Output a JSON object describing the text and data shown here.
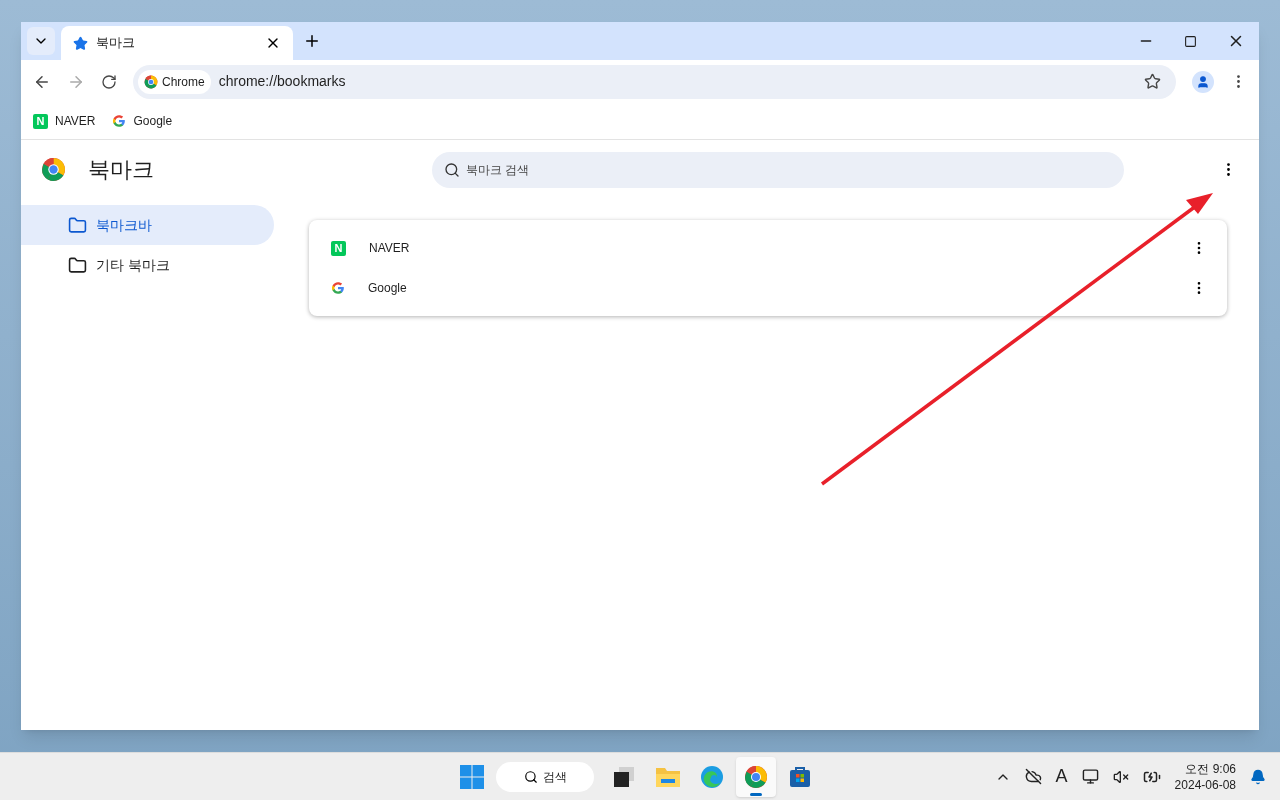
{
  "window": {
    "tabs": [
      {
        "title": "북마크",
        "selected": true
      }
    ]
  },
  "address_bar": {
    "chip": "Chrome",
    "url": "chrome://bookmarks"
  },
  "bookmarks_bar": [
    {
      "label": "NAVER",
      "kind": "naver",
      "logo_letter": "N"
    },
    {
      "label": "Google",
      "kind": "google"
    }
  ],
  "page": {
    "title": "북마크",
    "search": {
      "placeholder": "북마크 검색"
    },
    "sidebar": {
      "items": [
        {
          "label": "북마크바",
          "selected": true
        },
        {
          "label": "기타 북마크",
          "selected": false
        }
      ]
    },
    "bookmarks": [
      {
        "label": "NAVER",
        "kind": "naver",
        "logo_letter": "N"
      },
      {
        "label": "Google",
        "kind": "google"
      }
    ]
  },
  "taskbar": {
    "search": "검색",
    "apps": [
      {
        "kind": "taskview",
        "selected": false
      },
      {
        "kind": "files",
        "selected": false
      },
      {
        "kind": "edge",
        "selected": false
      },
      {
        "kind": "chrome",
        "selected": true
      },
      {
        "kind": "store",
        "selected": false
      }
    ],
    "input_mode": "A",
    "time": "오전 9:06",
    "date": "2024-06-08"
  }
}
